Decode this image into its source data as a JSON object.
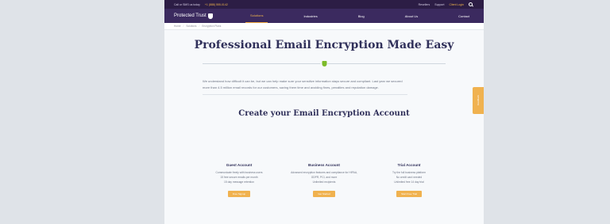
{
  "topbar": {
    "left_text": "Call or SMS us today",
    "phone": "+1 (888) 555-0142",
    "links": [
      "Resellers",
      "Support",
      "Client Login"
    ]
  },
  "navbar": {
    "logo": "Protected Trust",
    "items": [
      "Solutions",
      "Industries",
      "Blog",
      "About Us",
      "Contact"
    ],
    "active": "Solutions"
  },
  "breadcrumb": [
    "Home",
    "Solutions",
    "Encryption Plans"
  ],
  "hero": {
    "title": "Professional Email Encryption Made Easy",
    "intro": "We understand how difficult it can be, but we can help make sure your sensitive information stays secure and compliant. Last year we secured more than 4.5 million email records for our customers, saving them time and avoiding fines, penalties and reputation damage."
  },
  "section_title": "Create your Email Encryption Account",
  "plans": [
    {
      "title": "Guest Account",
      "desc": [
        "Communicate freely with business users",
        "15 free secure emails per month",
        "15 day message retention"
      ],
      "button": "Free Signup"
    },
    {
      "title": "Business Account",
      "desc": [
        "Advanced encryption features and compliance for HIPAA, GDPR, PCI, and more",
        "Unlimited recipients"
      ],
      "button": "Get Started"
    },
    {
      "title": "Trial Account",
      "desc": [
        "Try the full business platform",
        "No credit card needed",
        "Unlimited free 14 day trial"
      ],
      "button": "Start Free Trial"
    }
  ],
  "side_tab": "Feedback",
  "colors": {
    "brand_purple": "#3b2a5f",
    "accent_orange": "#f0b24f",
    "shield_green": "#7dbb2a"
  }
}
